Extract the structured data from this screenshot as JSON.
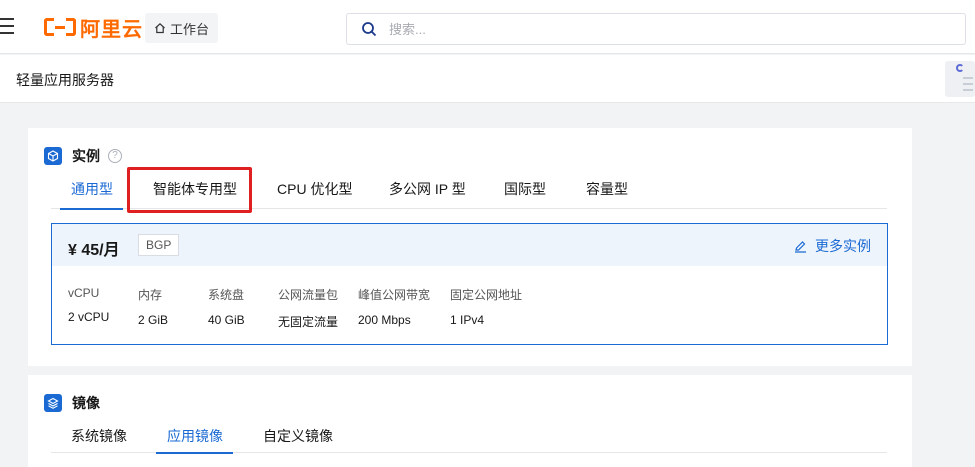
{
  "header": {
    "logo_text": "阿里云",
    "workbench_label": "工作台",
    "search_placeholder": "搜索..."
  },
  "page": {
    "title": "轻量应用服务器"
  },
  "instance": {
    "title": "实例",
    "tabs": [
      {
        "label": "通用型",
        "active": true
      },
      {
        "label": "智能体专用型",
        "active": false,
        "highlighted": true
      },
      {
        "label": "CPU 优化型",
        "active": false
      },
      {
        "label": "多公网 IP 型",
        "active": false
      },
      {
        "label": "国际型",
        "active": false
      },
      {
        "label": "容量型",
        "active": false
      }
    ],
    "plan": {
      "price": "¥ 45/月",
      "network_tag": "BGP",
      "more_link": "更多实例",
      "specs": [
        {
          "label": "vCPU",
          "value": "2 vCPU"
        },
        {
          "label": "内存",
          "value": "2 GiB"
        },
        {
          "label": "系统盘",
          "value": "40 GiB"
        },
        {
          "label": "公网流量包",
          "value": "无固定流量"
        },
        {
          "label": "峰值公网带宽",
          "value": "200 Mbps"
        },
        {
          "label": "固定公网地址",
          "value": "1 IPv4"
        }
      ]
    }
  },
  "image": {
    "title": "镜像",
    "tabs": [
      {
        "label": "系统镜像",
        "active": false
      },
      {
        "label": "应用镜像",
        "active": true
      },
      {
        "label": "自定义镜像",
        "active": false
      }
    ]
  },
  "colors": {
    "brand": "#ff6a00",
    "accent": "#1b6ad3",
    "highlight": "#e02020"
  }
}
